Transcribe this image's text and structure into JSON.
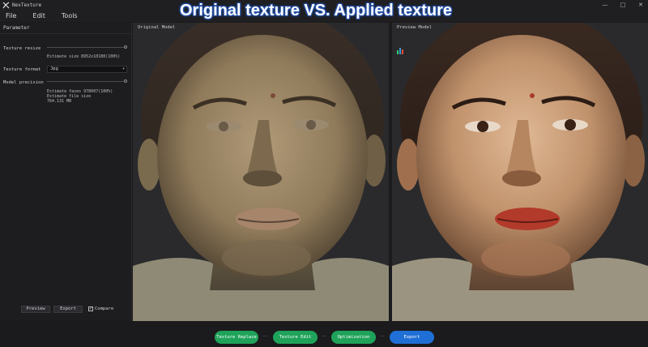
{
  "app": {
    "title": "NexTexture",
    "logo_icon": "app-logo-icon"
  },
  "window_controls": {
    "minimize": "—",
    "maximize": "□",
    "close": "✕"
  },
  "menu": [
    "File",
    "Edit",
    "Tools"
  ],
  "headline": "Original texture VS. Applied texture",
  "left_panel": {
    "header": "Parameter",
    "texture_resize_label": "Texture resize",
    "texture_resize_estimate": "Estimate size 8952x10180(100%)",
    "texture_format_label": "Texture format",
    "texture_format_value": "Jpg",
    "model_precision_label": "Model precision",
    "estimate_faces": "Estimate faces 978007(100%)",
    "estimate_file_size_label": "Estimate file size",
    "estimate_file_size_value": "764.131 MB",
    "preview_button": "Preview",
    "export_button": "Export",
    "compare_label": "Compare",
    "compare_checked": true
  },
  "viewports": {
    "original_label": "Original Model",
    "preview_label": "Preview Model"
  },
  "workflow": {
    "steps": [
      "Texture Replace",
      "Texture Edit",
      "Optimization",
      "Export"
    ],
    "separator": "···",
    "colors": {
      "green": "#1fa35a",
      "blue": "#1f6fd6"
    }
  }
}
